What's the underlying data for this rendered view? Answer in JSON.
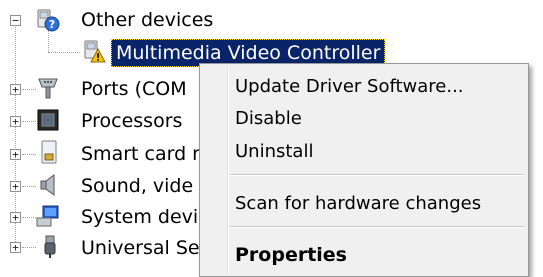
{
  "tree": {
    "items": [
      {
        "label": "Other devices",
        "icon": "unknown-device-icon",
        "expander": "−"
      },
      {
        "label": "Multimedia Video Controller",
        "icon": "warning-device-icon"
      },
      {
        "label": "Ports (COM",
        "icon": "port-icon",
        "expander": "+"
      },
      {
        "label": "Processors",
        "icon": "processor-icon",
        "expander": "+"
      },
      {
        "label": "Smart card r",
        "icon": "smart-card-icon",
        "expander": "+"
      },
      {
        "label": "Sound, vide",
        "icon": "speaker-icon",
        "expander": "+"
      },
      {
        "label": "System devi",
        "icon": "system-device-icon",
        "expander": "+"
      },
      {
        "label": "Universal Se",
        "icon": "usb-icon",
        "expander": "+"
      }
    ]
  },
  "context_menu": {
    "update_driver": "Update Driver Software...",
    "disable": "Disable",
    "uninstall": "Uninstall",
    "scan": "Scan for hardware changes",
    "properties": "Properties"
  },
  "colors": {
    "selection": "#0a246a",
    "menu_background": "#f0f0f0"
  }
}
